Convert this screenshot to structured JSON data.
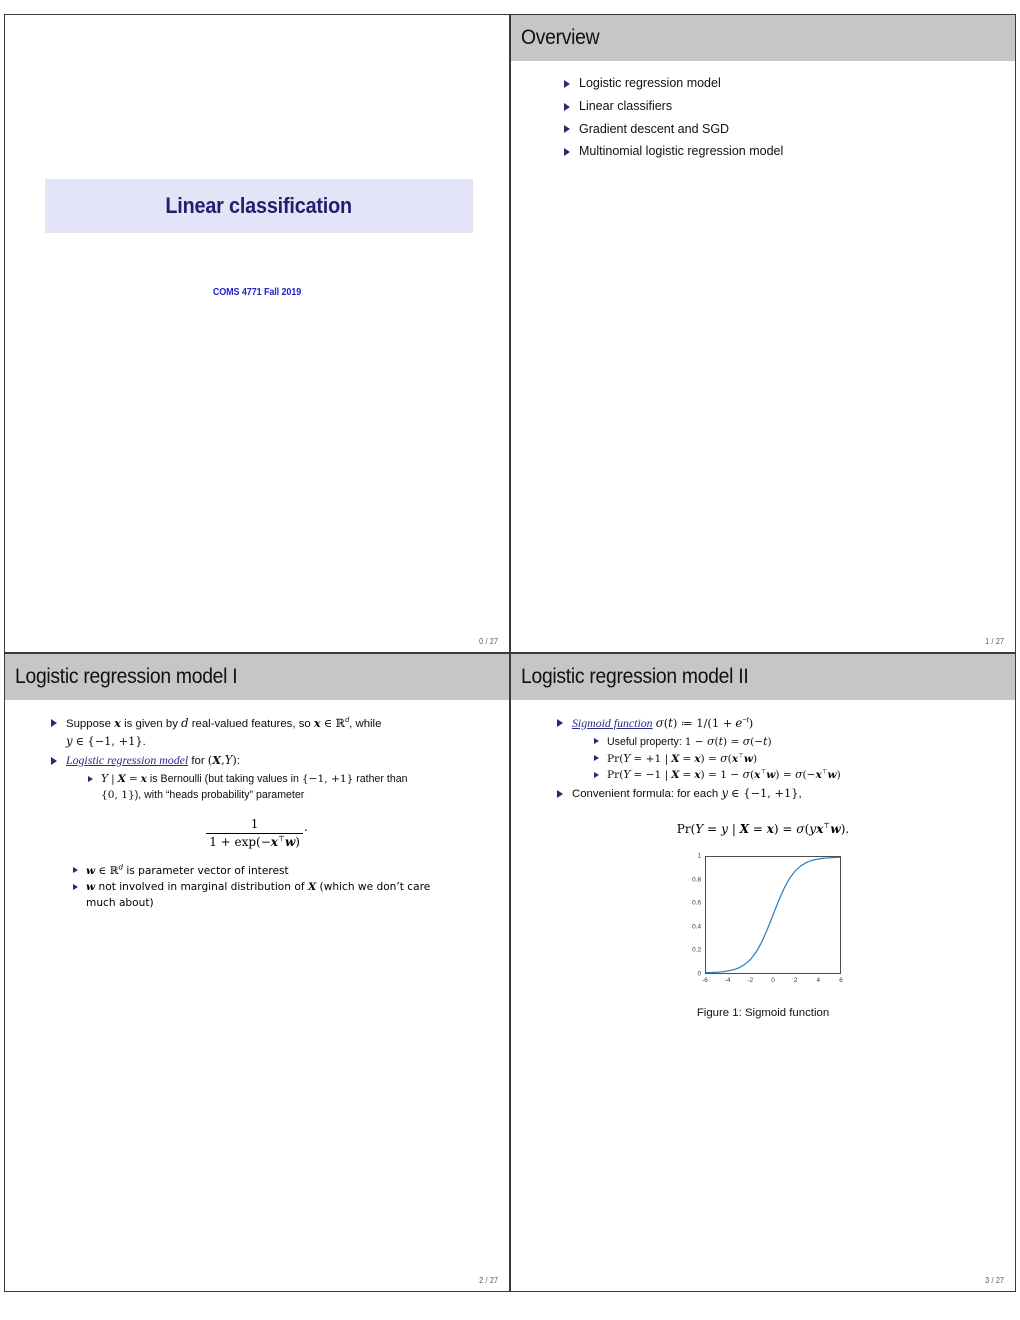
{
  "document": {
    "page_indicators": [
      "0 / 27",
      "1 / 27",
      "2 / 27",
      "3 / 27"
    ],
    "colors": {
      "header_band": "#c6c6c6",
      "title_box": "#e4e4f8",
      "title_text": "#1f1f6e",
      "subtitle_text": "#2222cc",
      "bullet_marker": "#2a2a72",
      "defined_term": "#2a2a8c",
      "curve": "#2f7fbf"
    }
  },
  "slides": [
    {
      "id": "title-slide",
      "title": "Linear classification",
      "subtitle": "COMS 4771 Fall 2019",
      "page": "0 / 27"
    },
    {
      "id": "overview-slide",
      "header": "Overview",
      "page": "1 / 27",
      "bullets": [
        "Logistic regression model",
        "Linear classifiers",
        "Gradient descent and SGD",
        "Multinomial logistic regression model"
      ]
    },
    {
      "id": "logistic-regression-model-1",
      "header": "Logistic regression model I",
      "page": "2 / 27",
      "bullet1_prefix": "Suppose ",
      "bullet1_mid": " is given by ",
      "bullet1_mid2": " real-valued features, so ",
      "bullet1_tail": ", while",
      "bullet1_line2_tail": ".",
      "bullet2_term": "Logistic regression model",
      "bullet2_tail": " for ",
      "bullet2_colon": ":",
      "sub1_a": " is Bernoulli (but taking values in ",
      "sub1_b": " rather than",
      "sub1_c": "), with “heads probability” parameter",
      "equation": {
        "numerator": "1",
        "denominator_prefix": "1 + exp(−",
        "denominator_suffix": ")",
        "trailing": "."
      },
      "sub2": " is parameter vector of interest",
      "sub3_a": " not involved in marginal distribution of ",
      "sub3_b": " (which we don’t care",
      "sub3_c": "much about)"
    },
    {
      "id": "logistic-regression-model-2",
      "header": "Logistic regression model II",
      "page": "3 / 27",
      "bullet1_term": "Sigmoid function",
      "sub_useful_label": "Useful property: ",
      "bullet_convenient": "Convenient formula: for each ",
      "bullet_convenient_tail": ",",
      "figure_caption": "Figure 1: Sigmoid function"
    }
  ],
  "chart_data": {
    "type": "line",
    "title": "Figure 1: Sigmoid function",
    "xlabel": "",
    "ylabel": "",
    "xlim": [
      -6,
      6
    ],
    "ylim": [
      0,
      1
    ],
    "xticks": [
      "-6",
      "-4",
      "-2",
      "0",
      "2",
      "4",
      "6"
    ],
    "xtick_values": [
      -6,
      -4,
      -2,
      0,
      2,
      4,
      6
    ],
    "yticks": [
      "0",
      "0.2",
      "0.4",
      "0.6",
      "0.8",
      "1"
    ],
    "ytick_values": [
      0,
      0.2,
      0.4,
      0.6,
      0.8,
      1
    ],
    "grid": false,
    "legend": null,
    "series": [
      {
        "name": "sigmoid",
        "color": "#2f7fbf",
        "x": [
          -6,
          -5.5,
          -5,
          -4.5,
          -4,
          -3.5,
          -3,
          -2.5,
          -2,
          -1.5,
          -1,
          -0.5,
          0,
          0.5,
          1,
          1.5,
          2,
          2.5,
          3,
          3.5,
          4,
          4.5,
          5,
          5.5,
          6
        ],
        "y": [
          0.002,
          0.004,
          0.007,
          0.011,
          0.018,
          0.029,
          0.047,
          0.076,
          0.119,
          0.182,
          0.269,
          0.378,
          0.5,
          0.622,
          0.731,
          0.818,
          0.881,
          0.924,
          0.953,
          0.971,
          0.982,
          0.989,
          0.993,
          0.996,
          0.998
        ]
      }
    ]
  }
}
